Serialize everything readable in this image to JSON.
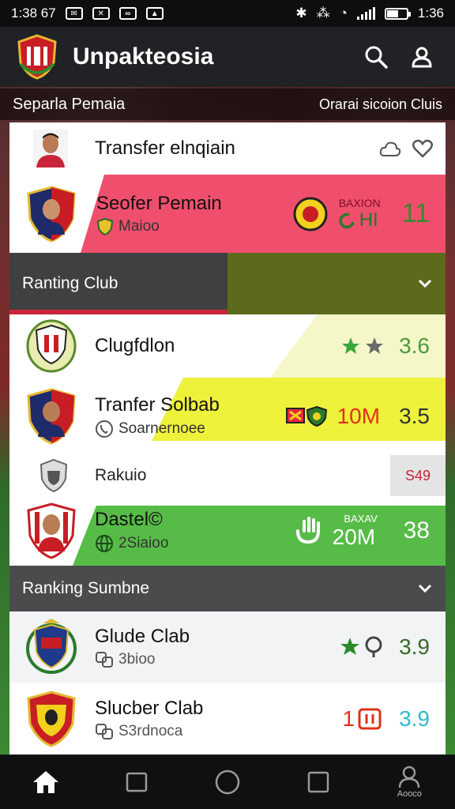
{
  "status_bar": {
    "time_left": "1:38 67",
    "time_right": "1:36"
  },
  "app_bar": {
    "title": "Unpakteosia"
  },
  "sub_header": {
    "left": "Separla Pemaia",
    "right": "Orarai sicoion Cluis"
  },
  "transfer_header": {
    "label": "Transfer elnqiain"
  },
  "featured": {
    "name": "Seofer Pemain",
    "sub": "Maioo",
    "tag": "BAXION",
    "tag2": "HI",
    "score": "11",
    "colors": {
      "band": "#ef4f6d"
    }
  },
  "section1": {
    "label": "Ranting Club"
  },
  "rows1": [
    {
      "name": "Clugfdlon",
      "score": "3.6"
    },
    {
      "name": "Tranfer Solbab",
      "sub": "Soarnernoee",
      "value": "10M",
      "score": "3.5"
    },
    {
      "name": "Rakuio",
      "badge": "S49"
    },
    {
      "name": "Dastel©",
      "sub": "2Siaioo",
      "tag": "BAXAV",
      "value": "20M",
      "score": "38"
    }
  ],
  "section2": {
    "label": "Ranking Sumbne"
  },
  "rows2": [
    {
      "name": "Glude Clab",
      "sub": "3bioo",
      "score": "3.9"
    },
    {
      "name": "Slucber Clab",
      "sub": "S3rdnoca",
      "value": "1",
      "score": "3.9"
    }
  ],
  "bottom_nav": {
    "profile_label": "Aooco"
  },
  "colors": {
    "red": "#e8263d",
    "yellow": "#eef23a",
    "green": "#57bb47",
    "olive": "#5c6a1c",
    "teal": "#2cbcc8"
  }
}
